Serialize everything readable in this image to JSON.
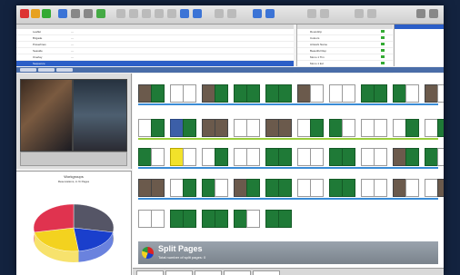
{
  "window": {
    "title": ""
  },
  "document_table": {
    "columns": [
      "",
      "",
      "",
      "",
      ""
    ],
    "rows": [
      {
        "name": "Leaflet"
      },
      {
        "name": "Brigade"
      },
      {
        "name": "Powerlines"
      },
      {
        "name": "Seaside"
      },
      {
        "name": "Overlay"
      },
      {
        "name": "Sequence"
      },
      {
        "name": "Covers"
      }
    ],
    "selected_row": 6
  },
  "side_table": {
    "rows": [
      {
        "label": "Roundtrip"
      },
      {
        "label": "Colours"
      },
      {
        "label": "Artwork Name"
      },
      {
        "label": "Beautiful Rep"
      },
      {
        "label": "Mono 1 Tim"
      },
      {
        "label": "Mono 1 Ed"
      },
      {
        "label": "Mono 2 Ed"
      }
    ]
  },
  "pie_panel": {
    "title": "Workgroups",
    "subtitle": "Reservations, in % Pages"
  },
  "split_pages": {
    "title": "Split Pages",
    "subtitle": "Total number of split pages: 0"
  },
  "chart_data": {
    "type": "pie",
    "title": "Workgroups",
    "subtitle": "Reservations, in % Pages",
    "series": [
      {
        "values": [
          28,
          20,
          24,
          28
        ],
        "colors": [
          "#555566",
          "#1a3fcc",
          "#f3d21f",
          "#e0334f"
        ]
      }
    ],
    "labels": [
      "",
      "",
      "",
      ""
    ]
  },
  "colors": {
    "accent": "#2b5ec7",
    "green_page": "#1f7a37",
    "background": "#13233f"
  }
}
